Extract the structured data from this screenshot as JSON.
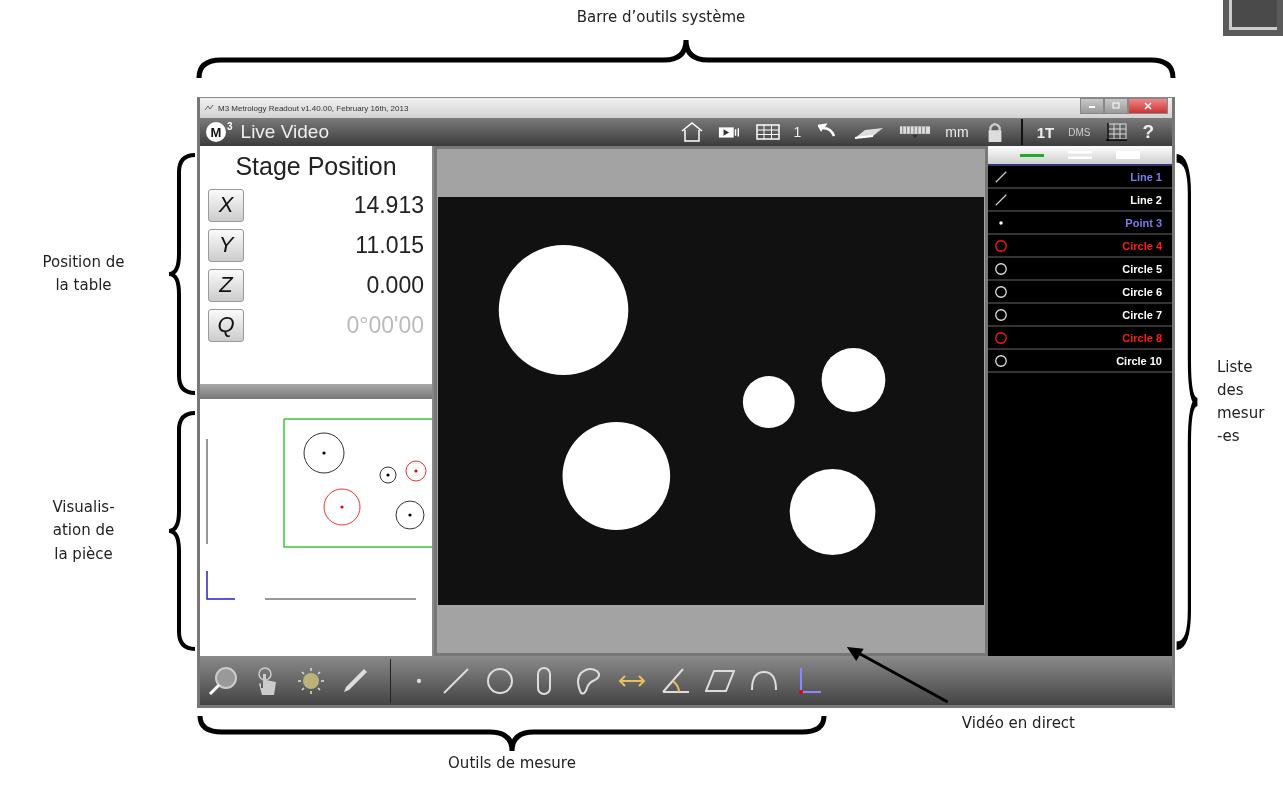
{
  "annotations": {
    "top": {
      "label": "Barre d’outils système"
    },
    "left": [
      {
        "lines": [
          "Position de",
          "la table"
        ]
      },
      {
        "lines": [
          "Visualis-",
          "ation de",
          "la pièce"
        ]
      }
    ],
    "right": {
      "lines": [
        "Liste",
        "des",
        "mesur",
        "-es"
      ]
    },
    "bottom": {
      "label": "Outils de mesure"
    },
    "video": {
      "label": "Vidéo en direct"
    }
  },
  "window": {
    "title": "M3 Metrology Readout  v1.40.00, February 16th, 2013"
  },
  "toolbar": {
    "logo_letter": "M",
    "logo_superscript": "3",
    "title": "Live Video",
    "page_number": "1",
    "unit": "mm",
    "mode": "1T",
    "angle_format": "DMS",
    "help": "?"
  },
  "stage": {
    "title": "Stage Position",
    "axes": [
      {
        "label": "X",
        "value": "14.913",
        "disabled": false
      },
      {
        "label": "Y",
        "value": "11.015",
        "disabled": false
      },
      {
        "label": "Z",
        "value": "0.000",
        "disabled": false
      },
      {
        "label": "Q",
        "value": "0°00'00",
        "disabled": true
      }
    ]
  },
  "measurements": [
    {
      "name": "Line 1",
      "kind": "line",
      "color": "#7b7bf0"
    },
    {
      "name": "Line 2",
      "kind": "line",
      "color": "#ffffff"
    },
    {
      "name": "Point 3",
      "kind": "point",
      "color": "#7b7bf0"
    },
    {
      "name": "Circle 4",
      "kind": "circle",
      "color": "#ff1a1a"
    },
    {
      "name": "Circle 5",
      "kind": "circle",
      "color": "#ffffff"
    },
    {
      "name": "Circle 6",
      "kind": "circle",
      "color": "#ffffff"
    },
    {
      "name": "Circle 7",
      "kind": "circle",
      "color": "#ffffff"
    },
    {
      "name": "Circle 8",
      "kind": "circle",
      "color": "#ff1a1a"
    },
    {
      "name": "Circle 10",
      "kind": "circle",
      "color": "#ffffff"
    }
  ]
}
